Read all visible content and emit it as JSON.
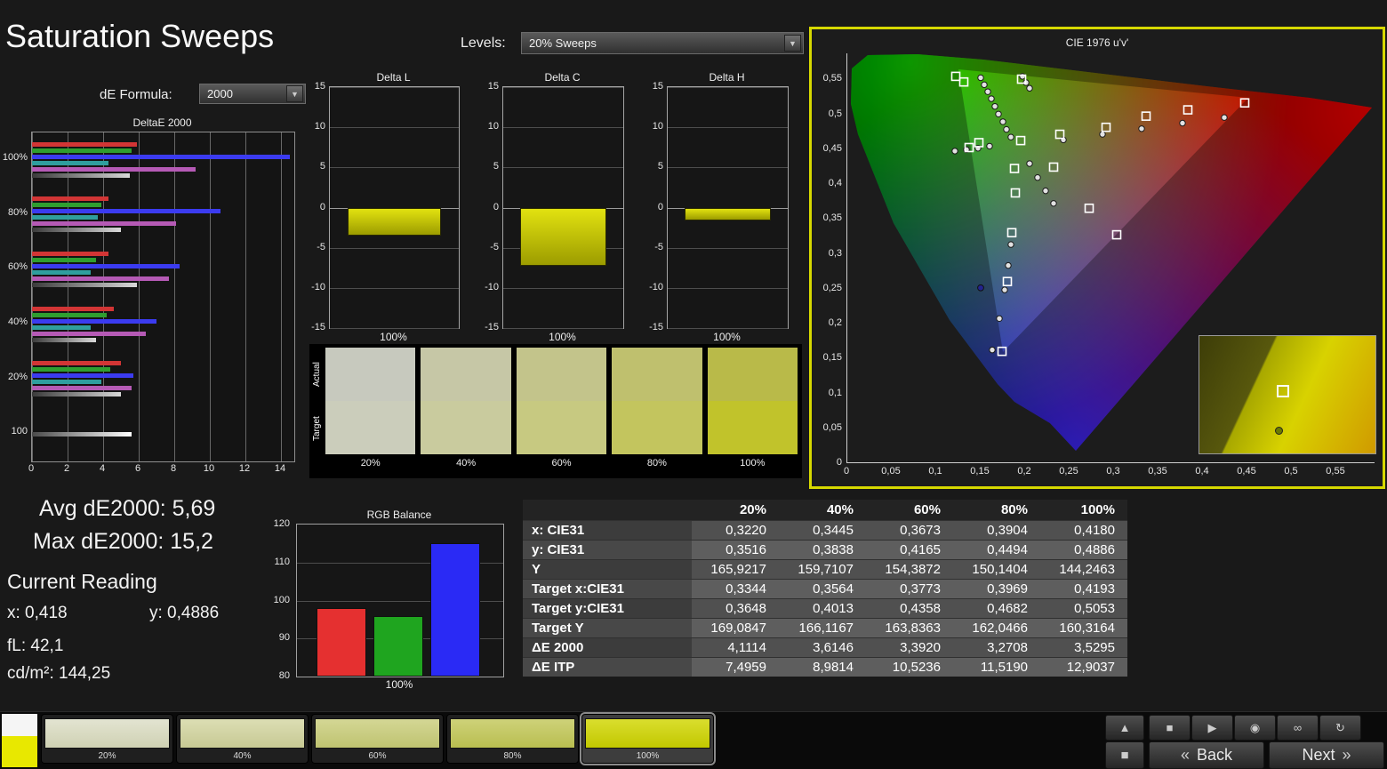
{
  "app": {
    "title": "Saturation Sweeps"
  },
  "controls": {
    "de_formula_label": "dE Formula:",
    "de_formula_value": "2000",
    "levels_label": "Levels:",
    "levels_value": "20% Sweeps"
  },
  "icons": {
    "dropdown_arrow": "▼",
    "collapse": "▲",
    "stop": "■",
    "play": "▶",
    "record": "◉",
    "loop": "∞",
    "refresh": "↻",
    "screen": "■",
    "back_chevron": "«",
    "next_chevron": "»"
  },
  "deltae_chart": {
    "title": "DeltaE 2000",
    "x_ticks": [
      "0",
      "2",
      "4",
      "6",
      "8",
      "10",
      "12",
      "14"
    ],
    "xlim": [
      0,
      14
    ],
    "groups": [
      {
        "label": "100%",
        "bars": [
          [
            "#d23535",
            5.9
          ],
          [
            "#2f9e2f",
            5.6
          ],
          [
            "#3b3bf0",
            14.5
          ],
          [
            "#2f9e9e",
            4.3
          ],
          [
            "#b55ab5",
            9.2
          ],
          [
            "sweep",
            5.5
          ]
        ]
      },
      {
        "label": "80%",
        "bars": [
          [
            "#d23535",
            4.3
          ],
          [
            "#2f9e2f",
            3.9
          ],
          [
            "#3b3bf0",
            10.6
          ],
          [
            "#2f9e9e",
            3.7
          ],
          [
            "#b55ab5",
            8.1
          ],
          [
            "sweep",
            5.0
          ]
        ]
      },
      {
        "label": "60%",
        "bars": [
          [
            "#d23535",
            4.3
          ],
          [
            "#2f9e2f",
            3.6
          ],
          [
            "#3b3bf0",
            8.3
          ],
          [
            "#2f9e9e",
            3.3
          ],
          [
            "#b55ab5",
            7.7
          ],
          [
            "sweep",
            5.9
          ]
        ]
      },
      {
        "label": "40%",
        "bars": [
          [
            "#d23535",
            4.6
          ],
          [
            "#2f9e2f",
            4.2
          ],
          [
            "#3b3bf0",
            7.0
          ],
          [
            "#2f9e9e",
            3.3
          ],
          [
            "#b55ab5",
            6.4
          ],
          [
            "sweep",
            3.6
          ]
        ]
      },
      {
        "label": "20%",
        "bars": [
          [
            "#d23535",
            5.0
          ],
          [
            "#2f9e2f",
            4.4
          ],
          [
            "#3b3bf0",
            5.7
          ],
          [
            "#2f9e9e",
            3.9
          ],
          [
            "#b55ab5",
            5.6
          ],
          [
            "sweep",
            5.0
          ]
        ]
      },
      {
        "label": "100",
        "bars": [
          [
            "white-sweep",
            5.6
          ]
        ]
      }
    ]
  },
  "delta_charts": [
    {
      "title": "Delta L",
      "value": -3.5,
      "x_label": "100%",
      "ylim": [
        -15,
        15
      ],
      "y_ticks": [
        "15",
        "10",
        "5",
        "0",
        "-5",
        "-10",
        "-15"
      ]
    },
    {
      "title": "Delta C",
      "value": -7.3,
      "x_label": "100%",
      "ylim": [
        -15,
        15
      ],
      "y_ticks": [
        "15",
        "10",
        "5",
        "0",
        "-5",
        "-10",
        "-15"
      ]
    },
    {
      "title": "Delta H",
      "value": -1.6,
      "x_label": "100%",
      "ylim": [
        -15,
        15
      ],
      "y_ticks": [
        "15",
        "10",
        "5",
        "0",
        "-5",
        "-10",
        "-15"
      ]
    }
  ],
  "swatch_strip": {
    "row_labels": [
      "Actual",
      "Target"
    ],
    "columns": [
      {
        "label": "20%",
        "actual": "#c7c9be",
        "target": "#cbcdbb"
      },
      {
        "label": "40%",
        "actual": "#c6c7a6",
        "target": "#c9cb9e"
      },
      {
        "label": "60%",
        "actual": "#c3c48b",
        "target": "#c7c981"
      },
      {
        "label": "80%",
        "actual": "#bfc06e",
        "target": "#c3c55e"
      },
      {
        "label": "100%",
        "actual": "#b9ba49",
        "target": "#c1c32b"
      }
    ]
  },
  "cie_chart": {
    "title": "CIE 1976 u'v'",
    "x_ticks": [
      "0",
      "0,05",
      "0,1",
      "0,15",
      "0,2",
      "0,25",
      "0,3",
      "0,35",
      "0,4",
      "0,45",
      "0,5",
      "0,55"
    ],
    "y_ticks": [
      "0,55",
      "0,5",
      "0,45",
      "0,4",
      "0,35",
      "0,3",
      "0,25",
      "0,2",
      "0,15",
      "0,1",
      "0,05",
      "0"
    ],
    "targets": [
      [
        0.122,
        0.553
      ],
      [
        0.131,
        0.545
      ],
      [
        0.196,
        0.549
      ],
      [
        0.148,
        0.458
      ],
      [
        0.137,
        0.451
      ],
      [
        0.195,
        0.461
      ],
      [
        0.239,
        0.47
      ],
      [
        0.291,
        0.48
      ],
      [
        0.336,
        0.496
      ],
      [
        0.383,
        0.505
      ],
      [
        0.447,
        0.515
      ],
      [
        0.188,
        0.421
      ],
      [
        0.232,
        0.423
      ],
      [
        0.189,
        0.386
      ],
      [
        0.272,
        0.364
      ],
      [
        0.185,
        0.329
      ],
      [
        0.303,
        0.326
      ],
      [
        0.18,
        0.259
      ],
      [
        0.174,
        0.159
      ]
    ],
    "measurements": [
      [
        0.15,
        0.551
      ],
      [
        0.154,
        0.541
      ],
      [
        0.158,
        0.531
      ],
      [
        0.162,
        0.521
      ],
      [
        0.166,
        0.51
      ],
      [
        0.17,
        0.499
      ],
      [
        0.175,
        0.488
      ],
      [
        0.179,
        0.477
      ],
      [
        0.184,
        0.466
      ],
      [
        0.197,
        0.553
      ],
      [
        0.201,
        0.544
      ],
      [
        0.205,
        0.536
      ],
      [
        0.243,
        0.462
      ],
      [
        0.287,
        0.47
      ],
      [
        0.331,
        0.478
      ],
      [
        0.377,
        0.486
      ],
      [
        0.424,
        0.494
      ],
      [
        0.16,
        0.453
      ],
      [
        0.147,
        0.45
      ],
      [
        0.134,
        0.448
      ],
      [
        0.121,
        0.446
      ],
      [
        0.205,
        0.428
      ],
      [
        0.214,
        0.408
      ],
      [
        0.223,
        0.389
      ],
      [
        0.232,
        0.371
      ],
      [
        0.184,
        0.312
      ],
      [
        0.181,
        0.282
      ],
      [
        0.177,
        0.247
      ],
      [
        0.171,
        0.206
      ],
      [
        0.163,
        0.161
      ]
    ],
    "dark_point": [
      0.15,
      0.25
    ],
    "inset": {
      "square": [
        0.47,
        0.46
      ],
      "dot": [
        0.45,
        0.8
      ]
    }
  },
  "readings": {
    "avg": "Avg dE2000: 5,69",
    "max": "Max dE2000: 15,2",
    "current_title": "Current Reading",
    "x": "x: 0,418",
    "y": "y: 0,4886",
    "fl": "fL: 42,1",
    "cd": "cd/m²: 144,25"
  },
  "rgb_balance": {
    "title": "RGB Balance",
    "x_label": "100%",
    "ylim": [
      80,
      120
    ],
    "y_ticks": [
      "120",
      "110",
      "100",
      "90",
      "80"
    ],
    "bars": [
      {
        "name": "red",
        "value": 98,
        "color": "#e53030"
      },
      {
        "name": "green",
        "value": 96,
        "color": "#1fa51f"
      },
      {
        "name": "blue",
        "value": 115,
        "color": "#2a2af5"
      }
    ]
  },
  "table": {
    "columns": [
      "20%",
      "40%",
      "60%",
      "80%",
      "100%"
    ],
    "rows": [
      {
        "label": "x: CIE31",
        "values": [
          "0,3220",
          "0,3445",
          "0,3673",
          "0,3904",
          "0,4180"
        ]
      },
      {
        "label": "y: CIE31",
        "values": [
          "0,3516",
          "0,3838",
          "0,4165",
          "0,4494",
          "0,4886"
        ]
      },
      {
        "label": "Y",
        "values": [
          "165,9217",
          "159,7107",
          "154,3872",
          "150,1404",
          "144,2463"
        ]
      },
      {
        "label": "Target x:CIE31",
        "values": [
          "0,3344",
          "0,3564",
          "0,3773",
          "0,3969",
          "0,4193"
        ]
      },
      {
        "label": "Target y:CIE31",
        "values": [
          "0,3648",
          "0,4013",
          "0,4358",
          "0,4682",
          "0,5053"
        ]
      },
      {
        "label": "Target Y",
        "values": [
          "169,0847",
          "166,1167",
          "163,8363",
          "162,0466",
          "160,3164"
        ]
      },
      {
        "label": "ΔE 2000",
        "values": [
          "4,1114",
          "3,6146",
          "3,3920",
          "3,2708",
          "3,5295"
        ]
      },
      {
        "label": "ΔE ITP",
        "values": [
          "7,4959",
          "8,9814",
          "10,5236",
          "11,5190",
          "12,9037"
        ]
      }
    ]
  },
  "bottom_bar": {
    "preview": {
      "top": "#f5f5f5",
      "bottom": "#e8e800"
    },
    "patches": [
      {
        "label": "20%",
        "top": "#e3e4d1",
        "bottom": "#cfd1b3"
      },
      {
        "label": "40%",
        "top": "#dcdeb4",
        "bottom": "#c7c994"
      },
      {
        "label": "60%",
        "top": "#d4d795",
        "bottom": "#bfc370"
      },
      {
        "label": "80%",
        "top": "#ced279",
        "bottom": "#b9be50"
      },
      {
        "label": "100%",
        "top": "#dade2e",
        "bottom": "#c2c800"
      }
    ],
    "selected_index": 4,
    "nav": {
      "back": "Back",
      "next": "Next"
    }
  }
}
